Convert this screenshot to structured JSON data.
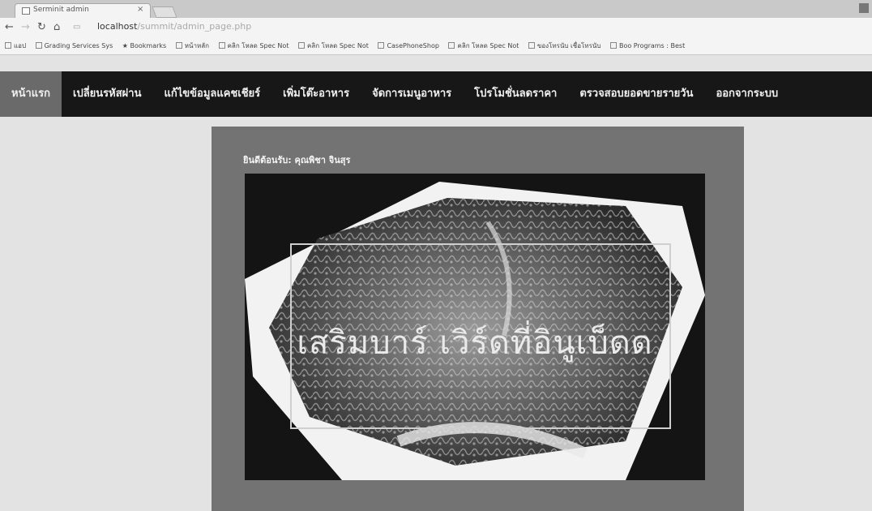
{
  "browser": {
    "tab_title": "Serminit admin",
    "tab_close": "×",
    "address_host": "localhost",
    "address_path": "/summit/admin_page.php",
    "bookmarks": [
      "แอป",
      "Grading Services Sys",
      "Bookmarks",
      "หน้าหลัก",
      "คลิก โหลด Spec Not",
      "คลิก โหลด Spec Not",
      "CasePhoneShop",
      "คลิก โหลด Spec Not",
      "ของโทรนับ เชื่อโทรนับ",
      "Boo Programs : Best"
    ]
  },
  "nav": {
    "items": [
      "หน้าแรก",
      "เปลี่ยนรหัสผ่าน",
      "แก้ไขข้อมูลแคชเชียร์",
      "เพิ่มโต๊ะอาหาร",
      "จัดการเมนูอาหาร",
      "โปรโมชั่นลดราคา",
      "ตรวจสอบยอดขายรายวัน",
      "ออกจากระบบ"
    ],
    "active_index": 0
  },
  "content": {
    "welcome": "ยินดีต้อนรับ: คุณพิชา จินสุร",
    "hero_text": "เสริมบาร์ เวิร์ดที่อินูเบ็ดด"
  }
}
